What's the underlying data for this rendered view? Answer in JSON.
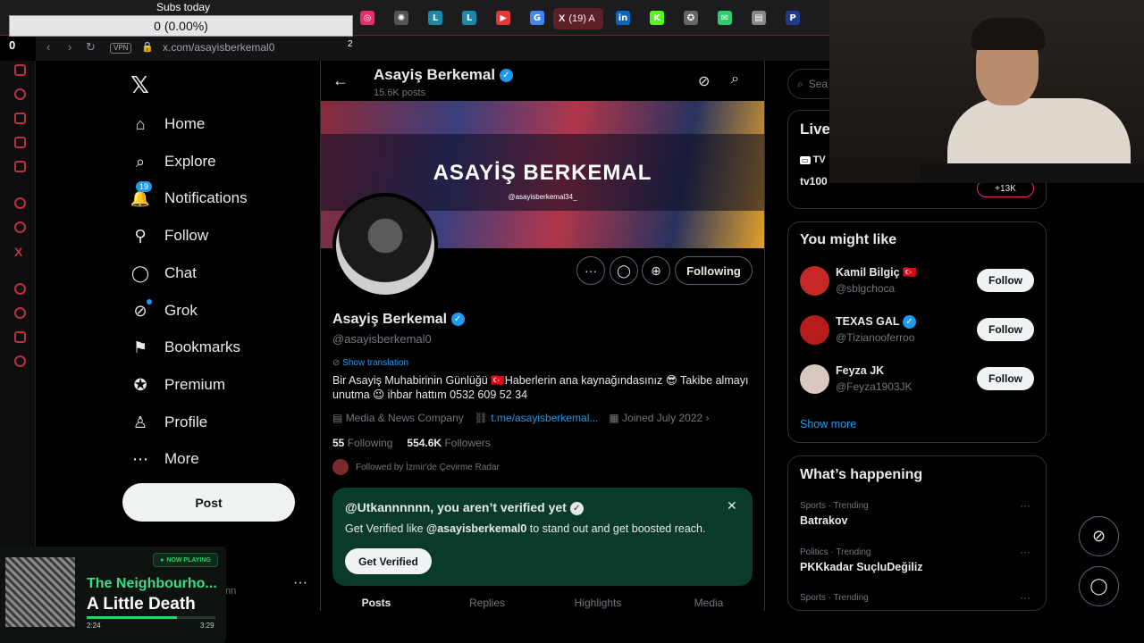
{
  "subs_overlay": {
    "label": "Subs today",
    "value": "0 (0.00%)",
    "left_counter": "0",
    "right_counter": "2"
  },
  "browser": {
    "url": "x.com/asayisberkemal0",
    "vpn": "VPN",
    "active_tab_label": "(19) A",
    "tab_icons": [
      {
        "icon": "instagram-icon",
        "color": "#e1306c",
        "glyph": "◎"
      },
      {
        "icon": "chatgpt-icon",
        "color": "#555555",
        "glyph": "✺"
      },
      {
        "icon": "letterboxd-icon",
        "color": "#1e88a8",
        "glyph": "L"
      },
      {
        "icon": "letterboxd-icon",
        "color": "#1e88a8",
        "glyph": "L"
      },
      {
        "icon": "video-icon",
        "color": "#e53935",
        "glyph": "▶"
      },
      {
        "icon": "google-icon",
        "color": "#4285f4",
        "glyph": "G"
      },
      {
        "icon": "linkedin-icon",
        "color": "#0a66c2",
        "glyph": "in"
      },
      {
        "icon": "kick-icon",
        "color": "#53fc18",
        "glyph": "K"
      },
      {
        "icon": "app-icon",
        "color": "#666666",
        "glyph": "✪"
      },
      {
        "icon": "chat-icon",
        "color": "#2ecc71",
        "glyph": "✉"
      },
      {
        "icon": "document-icon",
        "color": "#888888",
        "glyph": "▤"
      },
      {
        "icon": "paypal-icon",
        "color": "#1e3a8a",
        "glyph": "P"
      }
    ]
  },
  "nav": {
    "items": [
      {
        "label": "Home",
        "icon": "home-icon",
        "glyph": "⌂"
      },
      {
        "label": "Explore",
        "icon": "search-icon",
        "glyph": "⌕"
      },
      {
        "label": "Notifications",
        "icon": "bell-icon",
        "glyph": "🔔",
        "badge": "19"
      },
      {
        "label": "Follow",
        "icon": "add-user-icon",
        "glyph": "⚲"
      },
      {
        "label": "Chat",
        "icon": "chat-bubble-icon",
        "glyph": "◯"
      },
      {
        "label": "Grok",
        "icon": "grok-icon",
        "glyph": "⊘"
      },
      {
        "label": "Bookmarks",
        "icon": "bookmark-icon",
        "glyph": "⚑"
      },
      {
        "label": "Premium",
        "icon": "premium-icon",
        "glyph": "✪"
      },
      {
        "label": "Profile",
        "icon": "profile-icon",
        "glyph": "♙"
      },
      {
        "label": "More",
        "icon": "more-icon",
        "glyph": "⋯"
      }
    ],
    "post_label": "Post",
    "account_fragment": "nn",
    "account_more": "···"
  },
  "now_playing": {
    "badge": "NOW PLAYING",
    "artist": "The Neighbourho...",
    "title": "A Little Death",
    "current": "2:24",
    "length": "3:29",
    "progress": 0.7
  },
  "profile": {
    "header_name": "Asayiş Berkemal",
    "header_posts": "15.6K posts",
    "banner_title": "ASAYİŞ BERKEMAL",
    "banner_handle": "@asayisberkemal34_",
    "following_label": "Following",
    "name": "Asayiş Berkemal",
    "handle": "@asayisberkemal0",
    "show_translation": "Show translation",
    "bio": "Bir Asayiş Muhabirinin Günlüğü 🇹🇷Haberlerin ana kaynağındasınız 😎 Takibe almayı unutma 😉 ihbar hattım 0532 609 52 34",
    "category": "Media & News Company",
    "link": "t.me/asayisberkemal...",
    "joined": "Joined July 2022",
    "following_count": "55",
    "following_word": "Following",
    "followers_count": "554.6K",
    "followers_word": "Followers",
    "followed_by": "Followed by İzmir'de Çevirme Radar"
  },
  "verify": {
    "title": "@Utkannnnnn, you aren’t verified yet",
    "text_pre": "Get Verified like ",
    "text_handle": "@asayisberkemal0",
    "text_post": " to stand out and get boosted reach.",
    "button": "Get Verified"
  },
  "tabs": [
    "Posts",
    "Replies",
    "Highlights",
    "Media"
  ],
  "right": {
    "search_placeholder": "Sea",
    "live_title": "Live",
    "live_row1": "TV",
    "live_row2": "tv100",
    "live_pill": "+13K",
    "like_title": "You might like",
    "suggestions": [
      {
        "name": "Kamil Bilgiç 🇹🇷",
        "handle": "@sblgchoca",
        "button": "Follow",
        "color": "#c62828"
      },
      {
        "name": "TEXAS GAL",
        "handle": "@Tizianooferroo",
        "button": "Follow",
        "color": "#b71c1c",
        "verified": true
      },
      {
        "name": "Feyza JK",
        "handle": "@Feyza1903JK",
        "button": "Follow",
        "color": "#d8c8c0"
      }
    ],
    "show_more": "Show more",
    "happening_title": "What’s happening",
    "trends": [
      {
        "meta": "Sports · Trending",
        "name": "Batrakov"
      },
      {
        "meta": "Politics · Trending",
        "name": "PKKkadar SuçluDeğiliz"
      },
      {
        "meta": "Sports · Trending",
        "name": ""
      }
    ]
  },
  "colors": {
    "accent": "#1d9bf0",
    "verify_bg": "#0a3b2a",
    "now_playing_green": "#2fd36b"
  }
}
